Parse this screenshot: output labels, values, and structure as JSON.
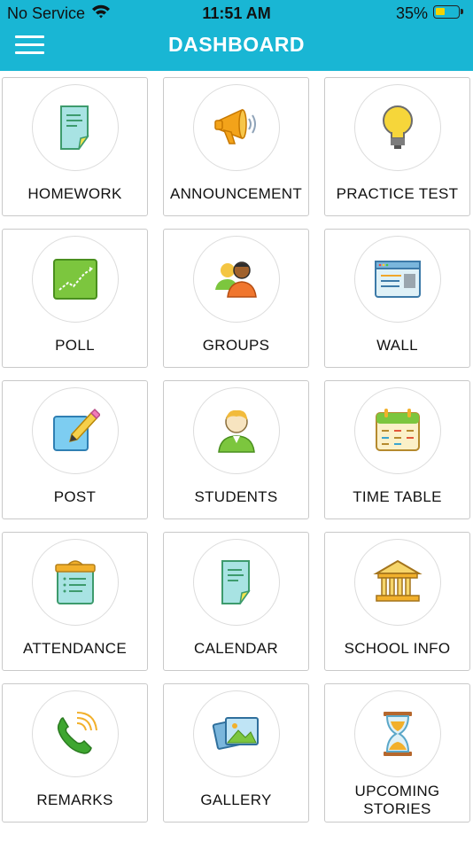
{
  "status_bar": {
    "carrier": "No Service",
    "time": "11:51 AM",
    "battery": "35%"
  },
  "header": {
    "title": "DASHBOARD"
  },
  "tiles": [
    {
      "label": "HOMEWORK",
      "icon": "homework-icon"
    },
    {
      "label": "ANNOUNCEMENT",
      "icon": "megaphone-icon"
    },
    {
      "label": "PRACTICE TEST",
      "icon": "lightbulb-icon"
    },
    {
      "label": "POLL",
      "icon": "chart-icon"
    },
    {
      "label": "GROUPS",
      "icon": "group-icon"
    },
    {
      "label": "WALL",
      "icon": "browser-icon"
    },
    {
      "label": "POST",
      "icon": "pencil-icon"
    },
    {
      "label": "STUDENTS",
      "icon": "student-icon"
    },
    {
      "label": "TIME TABLE",
      "icon": "calendar-icon"
    },
    {
      "label": "ATTENDANCE",
      "icon": "clipboard-icon"
    },
    {
      "label": "CALENDAR",
      "icon": "document-icon"
    },
    {
      "label": "SCHOOL INFO",
      "icon": "building-icon"
    },
    {
      "label": "REMARKS",
      "icon": "phone-icon"
    },
    {
      "label": "GALLERY",
      "icon": "gallery-icon"
    },
    {
      "label": "UPCOMING STORIES",
      "icon": "hourglass-icon"
    }
  ]
}
